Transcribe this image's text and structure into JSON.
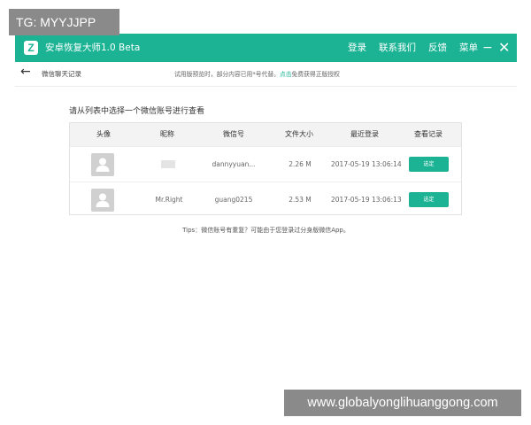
{
  "watermarks": {
    "top_left": "TG: MYYJJPP",
    "bottom_right": "www.globalyonglihuanggong.com"
  },
  "titlebar": {
    "logo_letter": "Z",
    "title": "安卓恢复大师1.0 Beta",
    "menu": [
      "登录",
      "联系我们",
      "反馈",
      "菜单"
    ],
    "minimize": "−",
    "close": "✕"
  },
  "subbar": {
    "back_icon": "←",
    "title": "微信聊天记录",
    "notice_prefix": "试用版预览时，部分内容已用*号代替。",
    "notice_link": "点击",
    "notice_suffix": "免费获得正版授权"
  },
  "main": {
    "prompt": "请从列表中选择一个微信账号进行查看",
    "columns": [
      "头像",
      "昵称",
      "微信号",
      "文件大小",
      "最近登录",
      "查看记录"
    ],
    "rows": [
      {
        "nickname": "",
        "wechat_id": "dannyyuan...",
        "size": "2.26 M",
        "last_login": "2017-05-19 13:06:14",
        "action": "选定"
      },
      {
        "nickname": "Mr.Right",
        "wechat_id": "guang0215",
        "size": "2.53 M",
        "last_login": "2017-05-19 13:06:13",
        "action": "选定"
      }
    ],
    "tips": "Tips：微信账号有重复？可能由于您登录过分身版微信App。"
  },
  "colors": {
    "accent": "#1bb394",
    "header_bg": "#f3f3f3",
    "avatar": "#d0d0d0"
  },
  "icons": {
    "back": "arrow-left-icon",
    "avatar": "user-silhouette-icon",
    "logo": "app-logo-icon"
  }
}
